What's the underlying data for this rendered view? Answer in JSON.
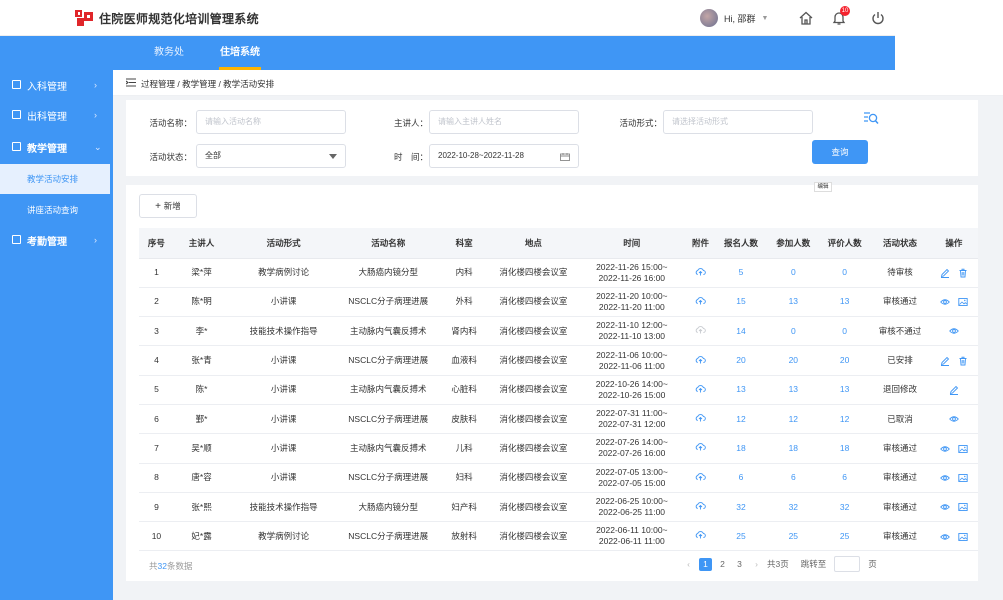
{
  "app": {
    "title": "住院医师规范化培训管理系统"
  },
  "user": {
    "greeting": "Hi, ",
    "name": "邵群",
    "notification_count": "10"
  },
  "nav": {
    "tabs": [
      {
        "label": "教务处",
        "active": false
      },
      {
        "label": "住培系统",
        "active": true
      }
    ]
  },
  "sidebar": {
    "items": [
      {
        "label": "入科管理"
      },
      {
        "label": "出科管理"
      },
      {
        "label": "教学管理"
      },
      {
        "label": "考勤管理"
      }
    ],
    "subitems": [
      {
        "label": "教学活动安排"
      },
      {
        "label": "讲座活动查询"
      }
    ]
  },
  "breadcrumb": "过程管理 / 教学管理 / 教学活动安排",
  "filters": {
    "activity_name": {
      "label": "活动名称：",
      "placeholder": "请输入活动名称"
    },
    "speaker": {
      "label": "主讲人：",
      "placeholder": "请输入主讲人姓名"
    },
    "form": {
      "label": "活动形式：",
      "placeholder": "请选择活动形式"
    },
    "status": {
      "label": "活动状态：",
      "value": "全部"
    },
    "time": {
      "label": "时　间：",
      "value": "2022-10-28~2022-11-28"
    },
    "search_label": "查询"
  },
  "toolbar": {
    "add_label": "新增"
  },
  "table": {
    "headers": [
      "序号",
      "主讲人",
      "活动形式",
      "活动名称",
      "科室",
      "地点",
      "时间",
      "附件",
      "报名人数",
      "参加人数",
      "评价人数",
      "活动状态",
      "操作"
    ],
    "rows": [
      {
        "no": "1",
        "speaker": "梁*萍",
        "form": "教学病例讨论",
        "name": "大肠癌内镜分型",
        "dept": "内科",
        "place": "消化楼四楼会议室",
        "time1": "2022-11-26 15:00~",
        "time2": "2022-11-26 16:00",
        "signup": "5",
        "attend": "0",
        "rate": "0",
        "status": "待审核",
        "ops": [
          "edit",
          "delete"
        ]
      },
      {
        "no": "2",
        "speaker": "陈*明",
        "form": "小讲课",
        "name": "NSCLC分子病理进展",
        "dept": "外科",
        "place": "消化楼四楼会议室",
        "time1": "2022-11-20 10:00~",
        "time2": "2022-11-20 11:00",
        "signup": "15",
        "attend": "13",
        "rate": "13",
        "status": "审核通过",
        "ops": [
          "view",
          "image"
        ]
      },
      {
        "no": "3",
        "speaker": "李*",
        "form": "技能技术操作指导",
        "name": "主动脉内气囊反搏术",
        "dept": "肾内科",
        "place": "消化楼四楼会议室",
        "time1": "2022-11-10 12:00~",
        "time2": "2022-11-10 13:00",
        "signup": "14",
        "attend": "0",
        "rate": "0",
        "status": "审核不通过",
        "ops": [
          "view"
        ]
      },
      {
        "no": "4",
        "speaker": "张*青",
        "form": "小讲课",
        "name": "NSCLC分子病理进展",
        "dept": "血液科",
        "place": "消化楼四楼会议室",
        "time1": "2022-11-06 10:00~",
        "time2": "2022-11-06 11:00",
        "signup": "20",
        "attend": "20",
        "rate": "20",
        "status": "已安排",
        "ops": [
          "edit",
          "delete"
        ]
      },
      {
        "no": "5",
        "speaker": "陈*",
        "form": "小讲课",
        "name": "主动脉内气囊反搏术",
        "dept": "心脏科",
        "place": "消化楼四楼会议室",
        "time1": "2022-10-26 14:00~",
        "time2": "2022-10-26 15:00",
        "signup": "13",
        "attend": "13",
        "rate": "13",
        "status": "退回修改",
        "ops": [
          "edit"
        ]
      },
      {
        "no": "6",
        "speaker": "鄞*",
        "form": "小讲课",
        "name": "NSCLC分子病理进展",
        "dept": "皮肤科",
        "place": "消化楼四楼会议室",
        "time1": "2022-07-31 11:00~",
        "time2": "2022-07-31 12:00",
        "signup": "12",
        "attend": "12",
        "rate": "12",
        "status": "已取消",
        "ops": [
          "view"
        ]
      },
      {
        "no": "7",
        "speaker": "吴*顺",
        "form": "小讲课",
        "name": "主动脉内气囊反搏术",
        "dept": "儿科",
        "place": "消化楼四楼会议室",
        "time1": "2022-07-26 14:00~",
        "time2": "2022-07-26 16:00",
        "signup": "18",
        "attend": "18",
        "rate": "18",
        "status": "审核通过",
        "ops": [
          "view",
          "image"
        ]
      },
      {
        "no": "8",
        "speaker": "唐*容",
        "form": "小讲课",
        "name": "NSCLC分子病理进展",
        "dept": "妇科",
        "place": "消化楼四楼会议室",
        "time1": "2022-07-05 13:00~",
        "time2": "2022-07-05 15:00",
        "signup": "6",
        "attend": "6",
        "rate": "6",
        "status": "审核通过",
        "ops": [
          "view",
          "image"
        ]
      },
      {
        "no": "9",
        "speaker": "张*熙",
        "form": "技能技术操作指导",
        "name": "大肠癌内镜分型",
        "dept": "妇产科",
        "place": "消化楼四楼会议室",
        "time1": "2022-06-25 10:00~",
        "time2": "2022-06-25 11:00",
        "signup": "32",
        "attend": "32",
        "rate": "32",
        "status": "审核通过",
        "ops": [
          "view",
          "image"
        ]
      },
      {
        "no": "10",
        "speaker": "妃*露",
        "form": "教学病例讨论",
        "name": "NSCLC分子病理进展",
        "dept": "放射科",
        "place": "消化楼四楼会议室",
        "time1": "2022-06-11 10:00~",
        "time2": "2022-06-11 11:00",
        "signup": "25",
        "attend": "25",
        "rate": "25",
        "status": "审核通过",
        "ops": [
          "view",
          "image"
        ]
      }
    ]
  },
  "tooltip": "编辑",
  "footer": {
    "total_prefix": "共",
    "total_count": "32",
    "total_suffix": "条数据"
  },
  "pagination": {
    "pages": [
      "1",
      "2",
      "3"
    ],
    "total_pages": "共3页",
    "jump_label": "跳转至",
    "page_unit": "页"
  },
  "colors": {
    "primary": "#3f96f5",
    "accent": "#ffb400",
    "danger": "#f5222d"
  }
}
